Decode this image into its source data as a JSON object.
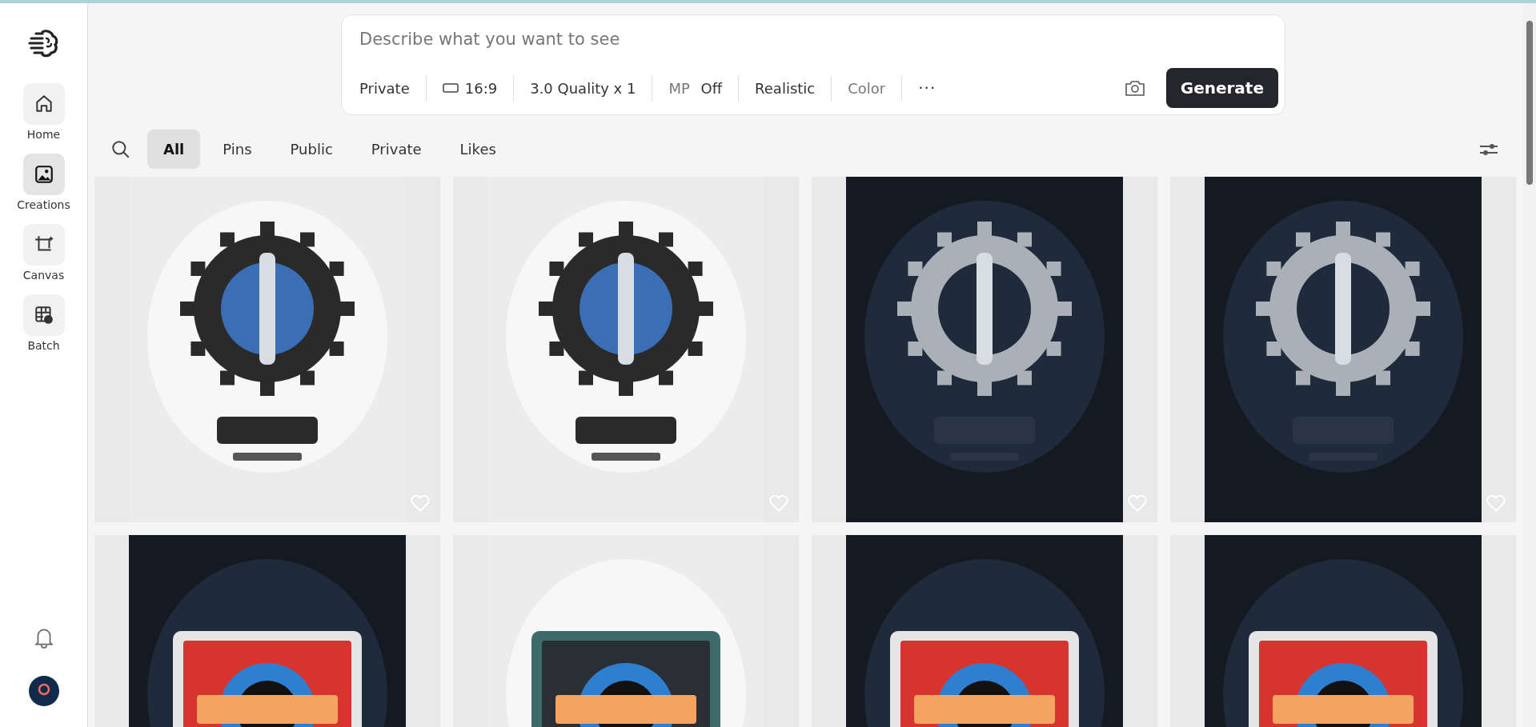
{
  "sidebar": {
    "items": [
      {
        "label": "Home",
        "selected": false
      },
      {
        "label": "Creations",
        "selected": true
      },
      {
        "label": "Canvas",
        "selected": false
      },
      {
        "label": "Batch",
        "selected": false
      }
    ]
  },
  "prompt": {
    "placeholder": "Describe what you want to see",
    "options": [
      {
        "kind": "text",
        "label": "Private"
      },
      {
        "kind": "ratio",
        "label": "16:9"
      },
      {
        "kind": "text",
        "label": "3.0 Quality x 1"
      },
      {
        "kind": "toggle",
        "prefix": "MP",
        "label": "Off"
      },
      {
        "kind": "text",
        "label": "Realistic"
      },
      {
        "kind": "muted",
        "label": "Color"
      },
      {
        "kind": "more",
        "label": "···"
      }
    ],
    "button": "Generate"
  },
  "filters": [
    {
      "label": "All",
      "selected": true
    },
    {
      "label": "Pins",
      "selected": false
    },
    {
      "label": "Public",
      "selected": false
    },
    {
      "label": "Private",
      "selected": false
    },
    {
      "label": "Likes",
      "selected": false
    }
  ]
}
